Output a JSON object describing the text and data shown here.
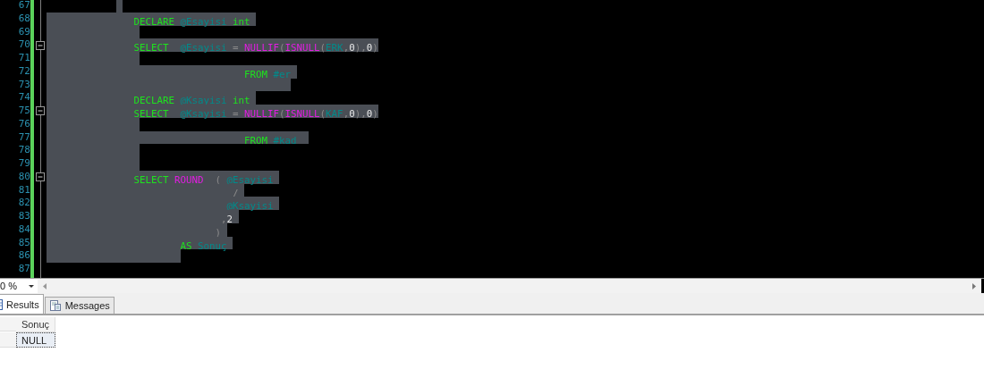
{
  "editor": {
    "lines": [
      {
        "number": "67",
        "foldable": false,
        "selected": true
      },
      {
        "number": "68",
        "foldable": false,
        "selected": true,
        "segments": [
          {
            "text": "DECLARE ",
            "kind": "keyword"
          },
          {
            "text": "@Esayisi ",
            "kind": "identifier"
          },
          {
            "text": "int",
            "kind": "keyword"
          }
        ]
      },
      {
        "number": "69",
        "foldable": false,
        "selected": true
      },
      {
        "number": "70",
        "foldable": true,
        "selected": true,
        "segments": [
          {
            "text": "SELECT  ",
            "kind": "keyword"
          },
          {
            "text": "@Esayisi",
            "kind": "identifier"
          },
          {
            "text": " = ",
            "kind": "operator"
          },
          {
            "text": "NULLIF",
            "kind": "function"
          },
          {
            "text": "(",
            "kind": "operator"
          },
          {
            "text": "ISNULL",
            "kind": "function"
          },
          {
            "text": "(",
            "kind": "operator"
          },
          {
            "text": "ERK",
            "kind": "identifier"
          },
          {
            "text": ",",
            "kind": "operator"
          },
          {
            "text": "0",
            "kind": "number"
          },
          {
            "text": "),",
            "kind": "operator"
          },
          {
            "text": "0",
            "kind": "number"
          },
          {
            "text": ")",
            "kind": "operator"
          }
        ]
      },
      {
        "number": "71",
        "foldable": false,
        "selected": true
      },
      {
        "number": "72",
        "foldable": false,
        "selected": true,
        "segments": [
          {
            "text": "FROM ",
            "kind": "keyword"
          },
          {
            "text": "#er",
            "kind": "identifier"
          }
        ]
      },
      {
        "number": "73",
        "foldable": false,
        "selected": true
      },
      {
        "number": "74",
        "foldable": false,
        "selected": true,
        "segments": [
          {
            "text": "DECLARE ",
            "kind": "keyword"
          },
          {
            "text": "@Ksayisi ",
            "kind": "identifier"
          },
          {
            "text": "int",
            "kind": "keyword"
          }
        ]
      },
      {
        "number": "75",
        "foldable": true,
        "selected": true,
        "segments": [
          {
            "text": "SELECT  ",
            "kind": "keyword"
          },
          {
            "text": "@Ksayisi",
            "kind": "identifier"
          },
          {
            "text": " = ",
            "kind": "operator"
          },
          {
            "text": "NULLIF",
            "kind": "function"
          },
          {
            "text": "(",
            "kind": "operator"
          },
          {
            "text": "ISNULL",
            "kind": "function"
          },
          {
            "text": "(",
            "kind": "operator"
          },
          {
            "text": "KAF",
            "kind": "identifier"
          },
          {
            "text": ",",
            "kind": "operator"
          },
          {
            "text": "0",
            "kind": "number"
          },
          {
            "text": "),",
            "kind": "operator"
          },
          {
            "text": "0",
            "kind": "number"
          },
          {
            "text": ")",
            "kind": "operator"
          }
        ]
      },
      {
        "number": "76",
        "foldable": false,
        "selected": true
      },
      {
        "number": "77",
        "foldable": false,
        "selected": true,
        "segments": [
          {
            "text": "FROM ",
            "kind": "keyword"
          },
          {
            "text": "#kad",
            "kind": "identifier"
          }
        ]
      },
      {
        "number": "78",
        "foldable": false,
        "selected": true
      },
      {
        "number": "79",
        "foldable": false,
        "selected": true
      },
      {
        "number": "80",
        "foldable": true,
        "selected": true,
        "segments": [
          {
            "text": "SELECT ",
            "kind": "keyword"
          },
          {
            "text": "ROUND",
            "kind": "function"
          },
          {
            "text": "  ( ",
            "kind": "operator"
          },
          {
            "text": "@Esayisi",
            "kind": "identifier"
          }
        ]
      },
      {
        "number": "81",
        "foldable": false,
        "selected": true,
        "segments": [
          {
            "text": "/",
            "kind": "operator"
          }
        ]
      },
      {
        "number": "82",
        "foldable": false,
        "selected": true,
        "segments": [
          {
            "text": "@Ksayisi",
            "kind": "identifier"
          }
        ]
      },
      {
        "number": "83",
        "foldable": false,
        "selected": true,
        "segments": [
          {
            "text": ",",
            "kind": "operator"
          },
          {
            "text": "2",
            "kind": "number"
          }
        ]
      },
      {
        "number": "84",
        "foldable": false,
        "selected": true,
        "segments": [
          {
            "text": ")",
            "kind": "operator"
          }
        ]
      },
      {
        "number": "85",
        "foldable": false,
        "selected": true,
        "segments": [
          {
            "text": "AS ",
            "kind": "keyword"
          },
          {
            "text": "Sonuç",
            "kind": "identifier"
          }
        ]
      },
      {
        "number": "86",
        "foldable": false,
        "selected": true
      },
      {
        "number": "87",
        "foldable": false,
        "selected": false
      }
    ]
  },
  "zoom": {
    "value": "0 %"
  },
  "result_tabs": [
    {
      "label": "Results",
      "kind": "grid",
      "selected": true
    },
    {
      "label": "Messages",
      "kind": "messages",
      "selected": false
    }
  ],
  "results": {
    "columns": [
      "Sonuç"
    ],
    "rows": [
      [
        "NULL"
      ]
    ]
  }
}
